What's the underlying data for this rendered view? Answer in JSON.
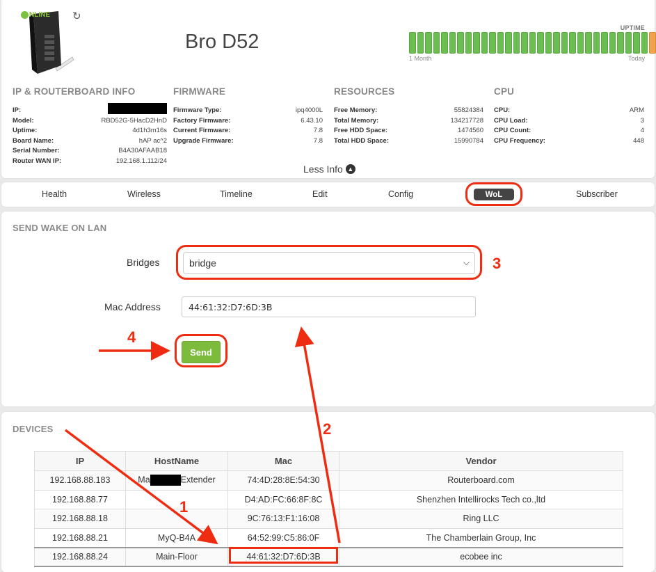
{
  "header": {
    "status": "NLINE",
    "device_name": "Bro D52",
    "uptime": {
      "label": "UPTIME",
      "range_start": "1 Month",
      "range_end": "Today",
      "bars": [
        "ok",
        "ok",
        "ok",
        "ok",
        "ok",
        "ok",
        "ok",
        "ok",
        "ok",
        "ok",
        "ok",
        "ok",
        "ok",
        "ok",
        "ok",
        "ok",
        "ok",
        "ok",
        "ok",
        "ok",
        "ok",
        "ok",
        "ok",
        "ok",
        "ok",
        "ok",
        "ok",
        "ok",
        "ok",
        "ok",
        "warn",
        "ok",
        "ok"
      ]
    },
    "sections": {
      "routerboard": {
        "title": "IP & ROUTERBOARD INFO",
        "rows": [
          {
            "k": "IP:",
            "v": ""
          },
          {
            "k": "Model:",
            "v": "RBD52G-5HacD2HnD"
          },
          {
            "k": "Uptime:",
            "v": "4d1h3m16s"
          },
          {
            "k": "Board Name:",
            "v": "hAP ac^2"
          },
          {
            "k": "Serial Number:",
            "v": "B4A30AFAAB18"
          },
          {
            "k": "Router WAN IP:",
            "v": "192.168.1.112/24"
          }
        ]
      },
      "firmware": {
        "title": "FIRMWARE",
        "rows": [
          {
            "k": "Firmware Type:",
            "v": "ipq4000L"
          },
          {
            "k": "Factory Firmware:",
            "v": "6.43.10"
          },
          {
            "k": "Current Firmware:",
            "v": "7.8"
          },
          {
            "k": "Upgrade Firmware:",
            "v": "7.8"
          }
        ]
      },
      "resources": {
        "title": "RESOURCES",
        "rows": [
          {
            "k": "Free Memory:",
            "v": "55824384"
          },
          {
            "k": "Total Memory:",
            "v": "134217728"
          },
          {
            "k": "Free HDD Space:",
            "v": "1474560"
          },
          {
            "k": "Total HDD Space:",
            "v": "15990784"
          }
        ]
      },
      "cpu": {
        "title": "CPU",
        "rows": [
          {
            "k": "CPU:",
            "v": "ARM"
          },
          {
            "k": "CPU Load:",
            "v": "3"
          },
          {
            "k": "CPU Count:",
            "v": "4"
          },
          {
            "k": "CPU Frequency:",
            "v": "448"
          }
        ]
      }
    },
    "less_info": "Less Info"
  },
  "tabs": {
    "health": "Health",
    "wireless": "Wireless",
    "timeline": "Timeline",
    "edit": "Edit",
    "config": "Config",
    "wol": "WoL",
    "subscriber": "Subscriber"
  },
  "wol": {
    "title": "SEND WAKE ON LAN",
    "bridges_label": "Bridges",
    "bridges_value": "bridge",
    "mac_label": "Mac Address",
    "mac_value": "44:61:32:D7:6D:3B",
    "send_label": "Send"
  },
  "devices": {
    "title": "DEVICES",
    "columns": {
      "ip": "IP",
      "hostname": "HostName",
      "mac": "Mac",
      "vendor": "Vendor"
    },
    "rows": [
      {
        "ip": "192.168.88.183",
        "hostname_prefix": "Ma",
        "hostname_suffix": "Extender",
        "mac": "74:4D:28:8E:54:30",
        "vendor": "Routerboard.com"
      },
      {
        "ip": "192.168.88.77",
        "hostname": "",
        "mac": "D4:AD:FC:66:8F:8C",
        "vendor": "Shenzhen Intellirocks Tech co.,ltd"
      },
      {
        "ip": "192.168.88.18",
        "hostname": "",
        "mac": "9C:76:13:F1:16:08",
        "vendor": "Ring LLC"
      },
      {
        "ip": "192.168.88.21",
        "hostname": "MyQ-B4A",
        "mac": "64:52:99:C5:86:0F",
        "vendor": "The Chamberlain Group, Inc"
      },
      {
        "ip": "192.168.88.24",
        "hostname": "Main-Floor",
        "mac": "44:61:32:D7:6D:3B",
        "vendor": "ecobee inc"
      }
    ]
  },
  "annotations": {
    "step1": "1",
    "step2": "2",
    "step3": "3",
    "step4": "4",
    "color": "#ee2c12"
  }
}
